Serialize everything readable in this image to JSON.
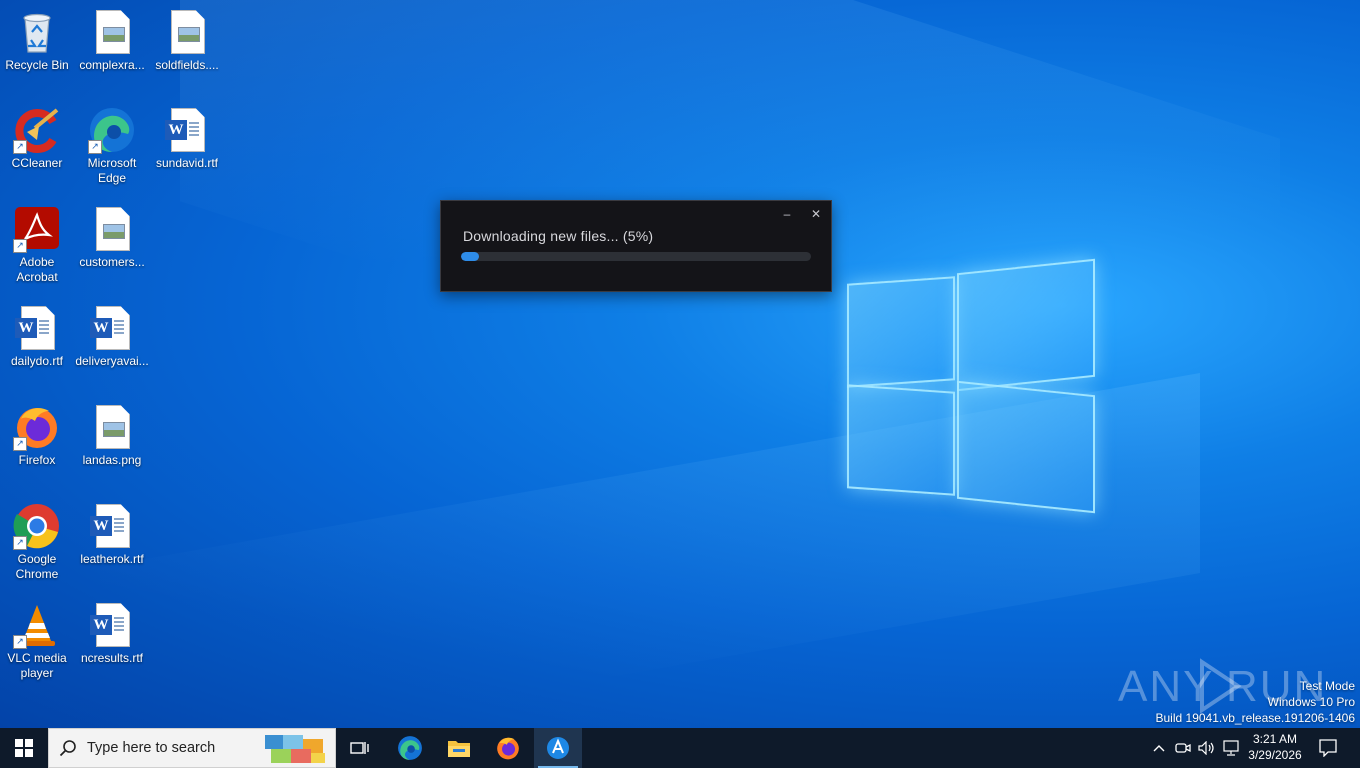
{
  "desktop": {
    "icons": [
      {
        "label": "Recycle Bin",
        "icon": "recycle-bin-icon"
      },
      {
        "label": "complexra...",
        "icon": "image-file-icon"
      },
      {
        "label": "soldfields....",
        "icon": "image-file-icon"
      },
      {
        "label": "CCleaner",
        "icon": "ccleaner-icon"
      },
      {
        "label": "Microsoft Edge",
        "icon": "edge-icon"
      },
      {
        "label": "sundavid.rtf",
        "icon": "word-doc-icon"
      },
      {
        "label": "Adobe Acrobat",
        "icon": "acrobat-icon"
      },
      {
        "label": "customers...",
        "icon": "image-file-icon"
      },
      {
        "label": "dailydo.rtf",
        "icon": "word-doc-icon"
      },
      {
        "label": "deliveryavai...",
        "icon": "word-doc-icon"
      },
      {
        "label": "Firefox",
        "icon": "firefox-icon"
      },
      {
        "label": "landas.png",
        "icon": "image-file-icon"
      },
      {
        "label": "Google Chrome",
        "icon": "chrome-icon"
      },
      {
        "label": "leatherok.rtf",
        "icon": "word-doc-icon"
      },
      {
        "label": "VLC media player",
        "icon": "vlc-icon"
      },
      {
        "label": "ncresults.rtf",
        "icon": "word-doc-icon"
      }
    ]
  },
  "dialog": {
    "message": "Downloading new files... (5%)",
    "progress": 0.05,
    "minimize_glyph": "–",
    "close_glyph": "✕"
  },
  "watermark": {
    "text_left": "ANY",
    "text_right": "RUN"
  },
  "system_info": {
    "line1": "Test Mode",
    "line2": "Windows 10 Pro",
    "line3": "Build 19041.vb_release.191206-1406"
  },
  "taskbar": {
    "search_placeholder": "Type here to search",
    "clock_time": "3:21 AM",
    "clock_date": "3/29/2026"
  },
  "colors": {
    "desktop_accent": "#0f7fe6",
    "taskbar_bg": "#0e1a2a",
    "progress_fill": "#2e8ce8"
  }
}
